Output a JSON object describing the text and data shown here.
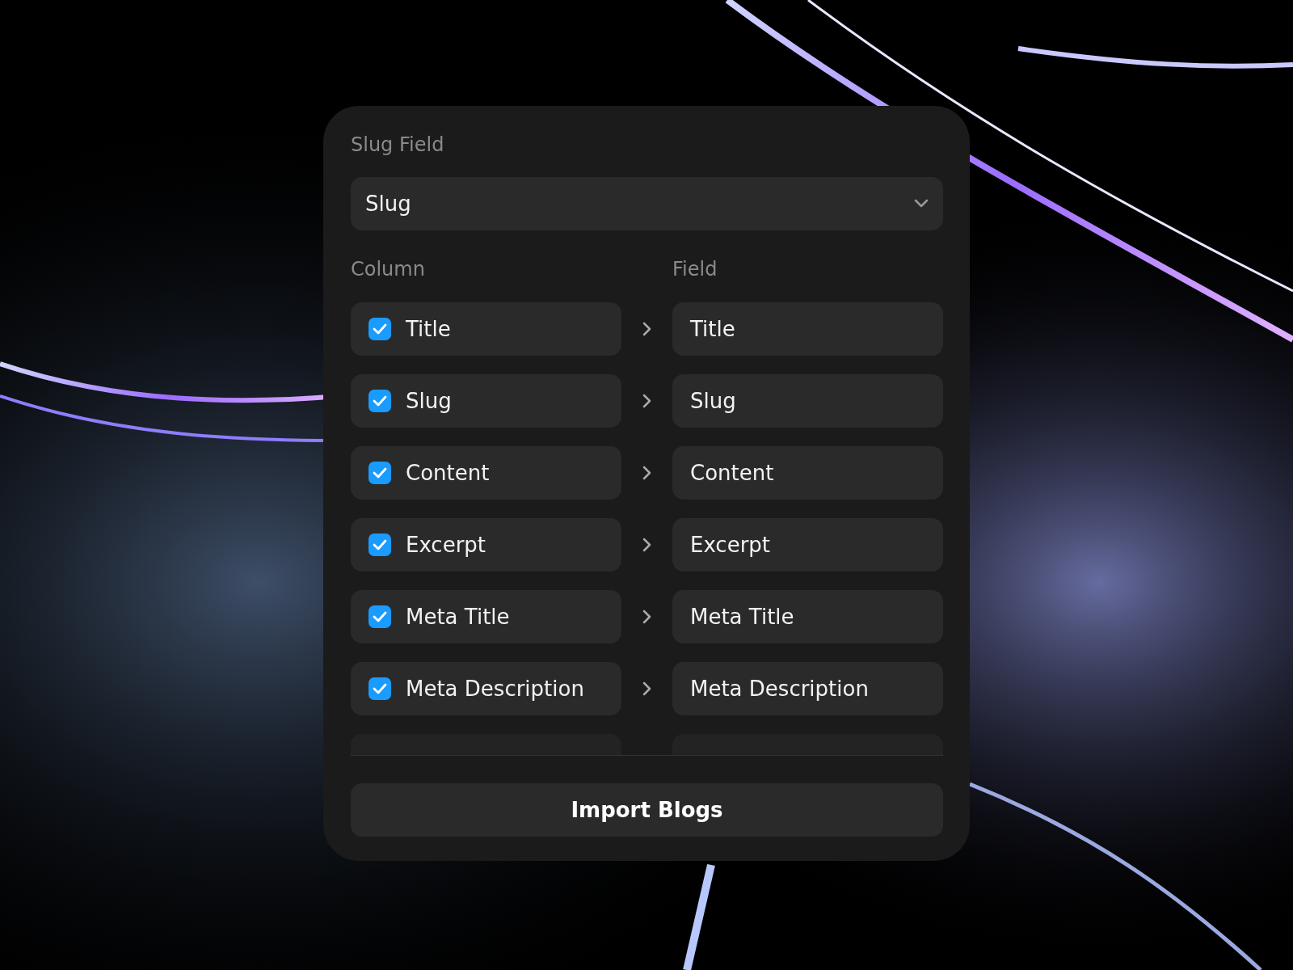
{
  "slug_field": {
    "label": "Slug Field",
    "value": "Slug"
  },
  "mapping": {
    "column_header": "Column",
    "field_header": "Field",
    "rows": [
      {
        "column": "Title",
        "checked": true,
        "field": "Title"
      },
      {
        "column": "Slug",
        "checked": true,
        "field": "Slug"
      },
      {
        "column": "Content",
        "checked": true,
        "field": "Content"
      },
      {
        "column": "Excerpt",
        "checked": true,
        "field": "Excerpt"
      },
      {
        "column": "Meta Title",
        "checked": true,
        "field": "Meta Title"
      },
      {
        "column": "Meta Description",
        "checked": true,
        "field": "Meta Description"
      }
    ]
  },
  "import_button": "Import Blogs"
}
